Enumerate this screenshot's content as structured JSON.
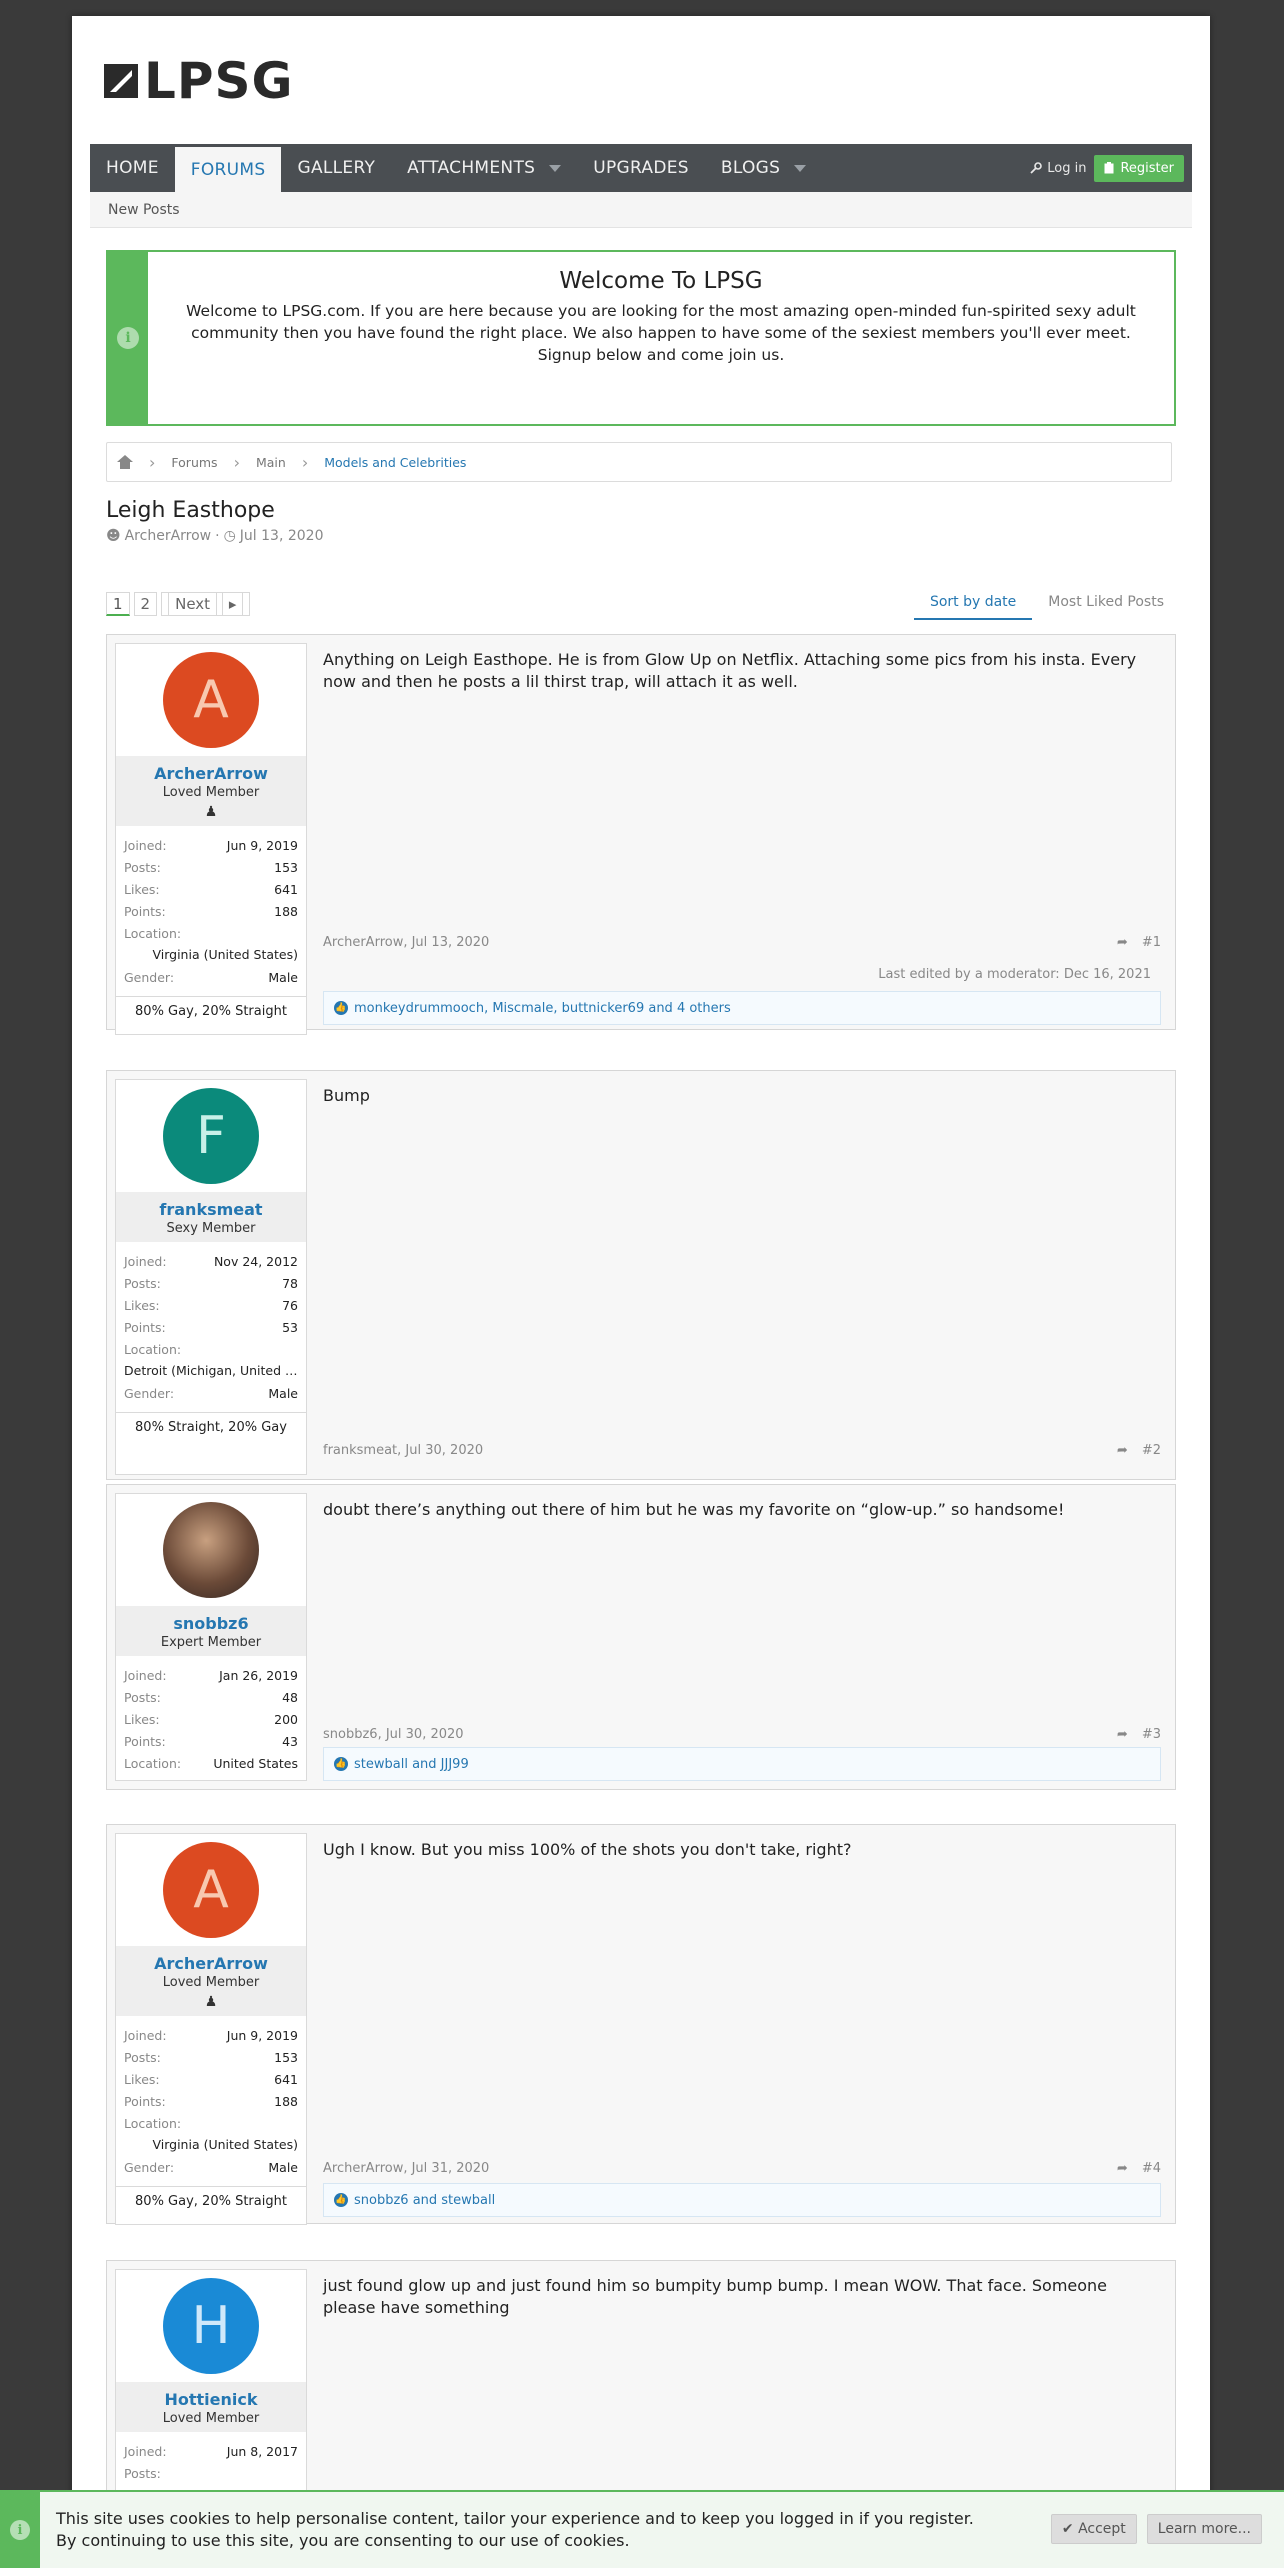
{
  "brand": {
    "logo_text": "LPSG"
  },
  "nav": {
    "tabs": [
      "HOME",
      "FORUMS",
      "GALLERY",
      "ATTACHMENTS",
      "UPGRADES",
      "BLOGS"
    ],
    "login": "Log in",
    "register": "Register"
  },
  "subnav": {
    "new_posts": "New Posts"
  },
  "welcome": {
    "title": "Welcome To LPSG",
    "text": "Welcome to LPSG.com. If you are here because you are looking for the most amazing open-minded fun-spirited sexy adult community then you have found the right place. We also happen to have some of the sexiest members you'll ever meet. Signup below and come join us."
  },
  "breadcrumb": [
    "Forums",
    "Main",
    "Models and Celebrities"
  ],
  "thread": {
    "title": "Leigh Easthope",
    "author": "ArcherArrow",
    "date": "Jul 13, 2020"
  },
  "pager": {
    "pages": [
      "1",
      "2"
    ],
    "next": "Next"
  },
  "sort": {
    "by_date": "Sort by date",
    "most_liked": "Most Liked Posts"
  },
  "labels": {
    "joined": "Joined:",
    "posts": "Posts:",
    "likes": "Likes:",
    "points": "Points:",
    "location": "Location:",
    "gender": "Gender:"
  },
  "posts": [
    {
      "user": {
        "initial": "A",
        "name": "ArcherArrow",
        "title": "Loved Member",
        "joined": "Jun 9, 2019",
        "posts": "153",
        "likes": "641",
        "points": "188",
        "location": "Virginia (United States)",
        "gender": "Male",
        "orientation": "80% Gay, 20% Straight"
      },
      "body": "Anything on Leigh Easthope. He is from Glow Up on Netflix. Attaching some pics from his insta. Every now and then he posts a lil thirst trap, will attach it as well.",
      "footer": "ArcherArrow, Jul 13, 2020",
      "num": "#1",
      "edited": "Last edited by a moderator: Dec 16, 2021",
      "likes": "monkeydrummooch, Miscmale, buttnicker69 and 4 others"
    },
    {
      "user": {
        "initial": "F",
        "name": "franksmeat",
        "title": "Sexy Member",
        "joined": "Nov 24, 2012",
        "posts": "78",
        "likes": "76",
        "points": "53",
        "location": "Detroit (Michigan, United States)",
        "gender": "Male",
        "orientation": "80% Straight, 20% Gay"
      },
      "body": "Bump",
      "footer": "franksmeat, Jul 30, 2020",
      "num": "#2"
    },
    {
      "user": {
        "name": "snobbz6",
        "title": "Expert Member",
        "joined": "Jan 26, 2019",
        "posts": "48",
        "likes": "200",
        "points": "43",
        "location": "United States"
      },
      "body": "doubt there’s anything out there of him but he was my favorite on “glow-up.” so handsome!",
      "footer": "snobbz6, Jul 30, 2020",
      "num": "#3",
      "likes": "stewball and JJJ99"
    },
    {
      "user": {
        "initial": "A",
        "name": "ArcherArrow",
        "title": "Loved Member",
        "joined": "Jun 9, 2019",
        "posts": "153",
        "likes": "641",
        "points": "188",
        "location": "Virginia (United States)",
        "gender": "Male",
        "orientation": "80% Gay, 20% Straight"
      },
      "body": "Ugh I know. But you miss 100% of the shots you don't take, right?",
      "footer": "ArcherArrow, Jul 31, 2020",
      "num": "#4",
      "likes": "snobbz6 and stewball"
    },
    {
      "user": {
        "initial": "H",
        "name": "Hottienick",
        "title": "Loved Member",
        "joined": "Jun 8, 2017"
      },
      "body": "just found glow up and just found him so bumpity bump bump. I mean WOW. That face. Someone please have something"
    }
  ],
  "cookie": {
    "line1": "This site uses cookies to help personalise content, tailor your experience and to keep you logged in if you register.",
    "line2": "By continuing to use this site, you are consenting to our use of cookies.",
    "accept": "Accept",
    "learn": "Learn more..."
  },
  "colors": {
    "accent": "#2577b1",
    "green": "#5cb85c",
    "avatar_a": "#dc4a21",
    "avatar_f": "#0b8a7b",
    "avatar_h": "#1a8ad6"
  }
}
